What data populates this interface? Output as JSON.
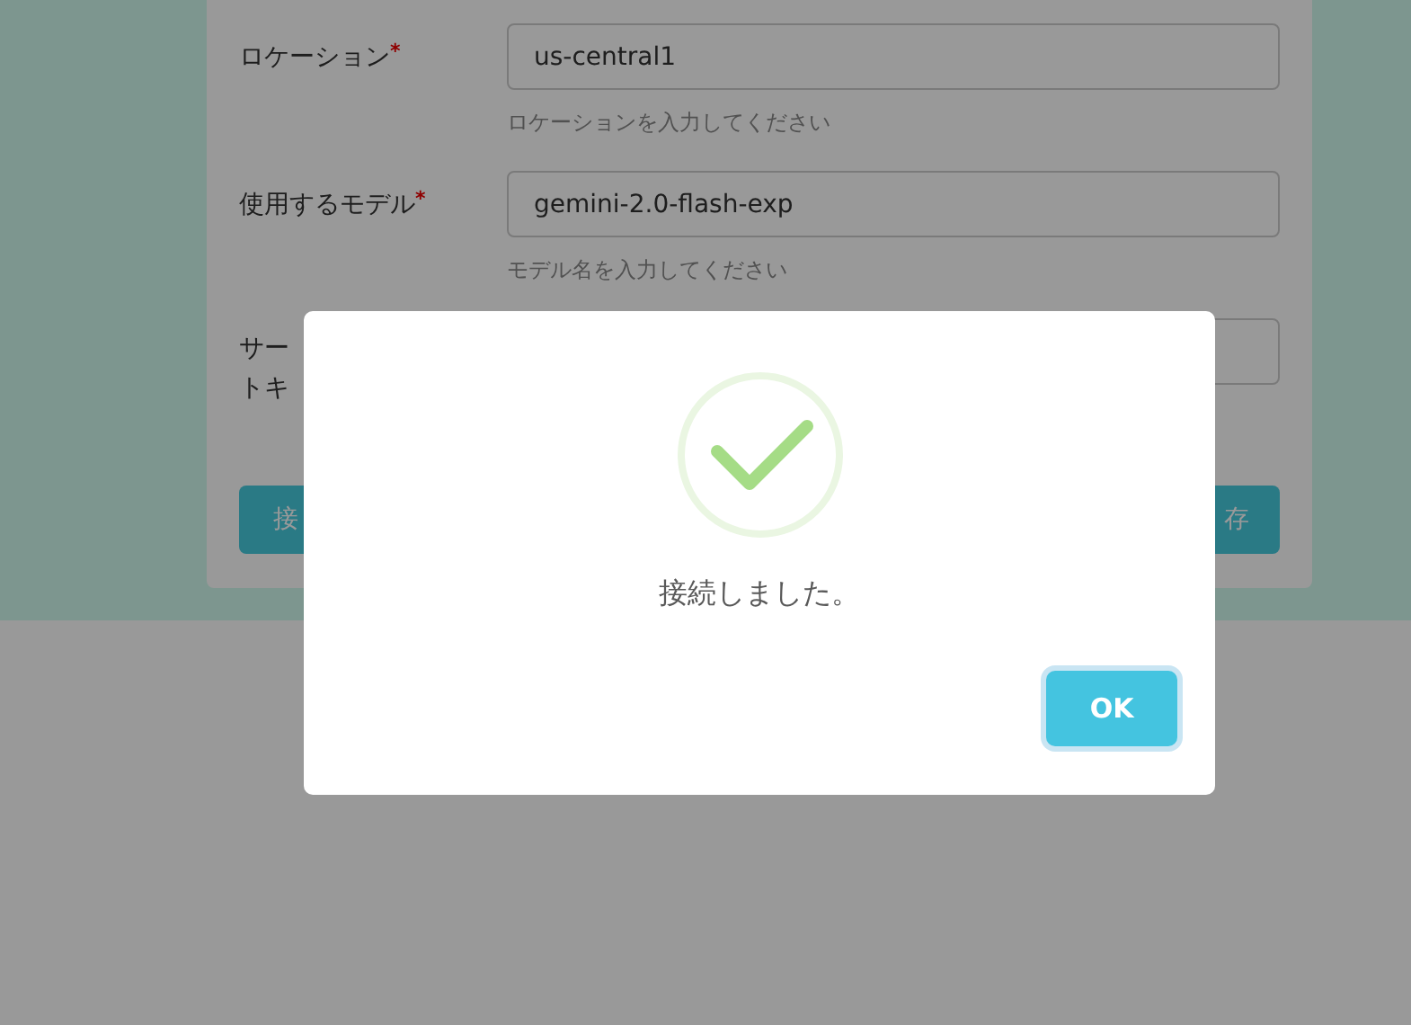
{
  "form": {
    "fields": [
      {
        "label_lines": [
          "ロケーション"
        ],
        "required_mark": "*",
        "value": "us-central1",
        "hint": "ロケーションを入力してください"
      },
      {
        "label_lines": [
          "使用するモデル"
        ],
        "required_mark": "*",
        "value": "gemini-2.0-flash-exp",
        "hint": "モデル名を入力してください"
      },
      {
        "label_lines": [
          "サー",
          "トキ"
        ]
      }
    ],
    "buttons": [
      {
        "label": "接"
      },
      {
        "label": "存"
      }
    ]
  },
  "dialog": {
    "message": "接続しました。",
    "confirm_button": {
      "label": "OK",
      "focused": true
    }
  }
}
